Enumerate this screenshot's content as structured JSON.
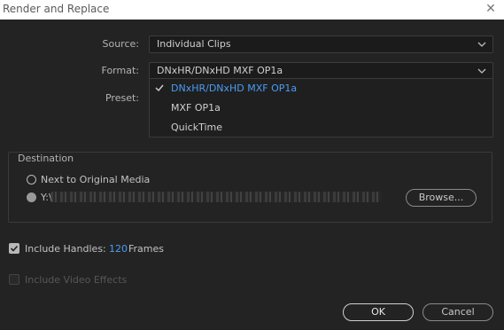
{
  "window": {
    "title": "Render and Replace"
  },
  "source": {
    "label": "Source:",
    "value": "Individual Clips"
  },
  "format": {
    "label": "Format:",
    "value": "DNxHR/DNxHD MXF OP1a",
    "options": [
      "DNxHR/DNxHD MXF OP1a",
      "MXF OP1a",
      "QuickTime"
    ],
    "selected_index": 0
  },
  "preset": {
    "label": "Preset:"
  },
  "destination": {
    "legend": "Destination",
    "next_to_original": "Next to Original Media",
    "custom_path_prefix": "Y:\\",
    "browse_label": "Browse..."
  },
  "handles": {
    "label": "Include Handles:",
    "value": "120",
    "unit": "Frames",
    "checked": true
  },
  "video_effects": {
    "label": "Include Video Effects",
    "checked": false,
    "enabled": false
  },
  "buttons": {
    "ok": "OK",
    "cancel": "Cancel"
  },
  "colors": {
    "accent": "#4a9cf5",
    "background": "#232323"
  }
}
